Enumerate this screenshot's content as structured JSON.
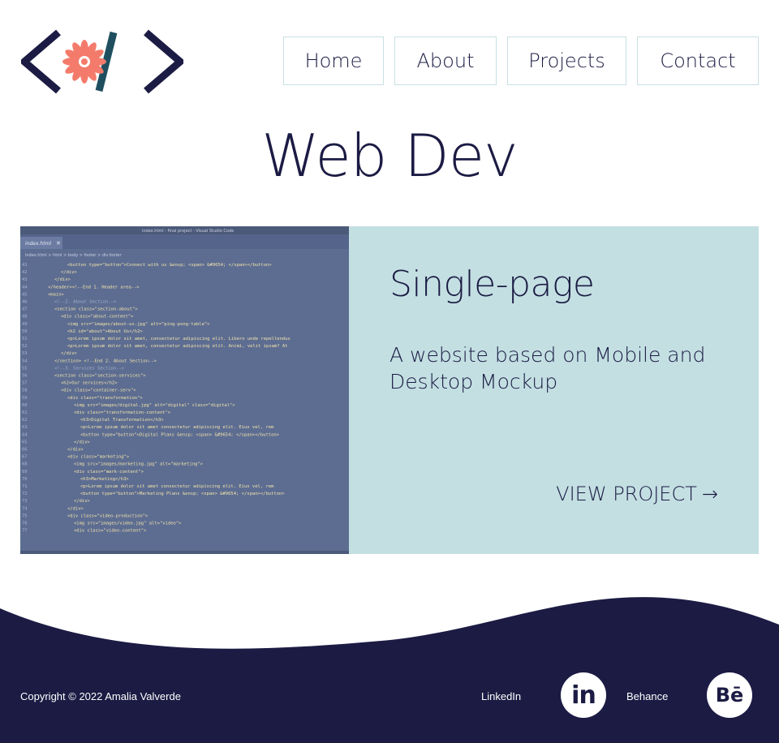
{
  "logo": {
    "alt": "code flower logo",
    "flower_color": "#f47b6b",
    "bracket_color": "#1b1b44",
    "slash_color": "#1f4f5f"
  },
  "nav": {
    "items": [
      {
        "label": "Home"
      },
      {
        "label": "About"
      },
      {
        "label": "Projects"
      },
      {
        "label": "Contact"
      }
    ]
  },
  "page": {
    "title": "Web Dev"
  },
  "project": {
    "title": "Single-page",
    "description": "A website based on Mobile and Desktop Mockup",
    "link_label": "VIEW PROJECT",
    "link_arrow": "→",
    "image_alt": "Visual Studio Code screenshot of index.html"
  },
  "screenshot_code": {
    "window_title": "index.html - final project - Visual Studio Code",
    "tab": "index.html",
    "breadcrumb": "index.html > html > body > footer > div.footer",
    "lines": [
      {
        "n": "41",
        "indent": 4,
        "text": "<button type=\"button\">Connect with us &ensp; <span> &#9654; </span></button>"
      },
      {
        "n": "42",
        "indent": 3,
        "text": "</div>"
      },
      {
        "n": "43",
        "indent": 2,
        "text": "</div>"
      },
      {
        "n": "44",
        "indent": 1,
        "text": "</header><!--End 1. Header area-->"
      },
      {
        "n": "45",
        "indent": 1,
        "text": "<main>"
      },
      {
        "n": "46",
        "indent": 2,
        "text": "<!--2. About Section-->"
      },
      {
        "n": "47",
        "indent": 2,
        "text": "<section class=\"section-about\">"
      },
      {
        "n": "48",
        "indent": 3,
        "text": "<div class=\"about-content\">"
      },
      {
        "n": "49",
        "indent": 4,
        "text": "<img src=\"images/about-us.jpg\" alt=\"ping-pong-table\">"
      },
      {
        "n": "50",
        "indent": 4,
        "text": "<h2 id=\"about\">About Us</h2>"
      },
      {
        "n": "51",
        "indent": 4,
        "text": "<p>Lorem ipsum dolor sit amet, consectetur adipiscing elit. Libero unde repellendus"
      },
      {
        "n": "52",
        "indent": 4,
        "text": "<p>Lorem ipsum dolor sit amet, consectetur adipiscing elit. Animi, velit ipsam? At"
      },
      {
        "n": "53",
        "indent": 3,
        "text": "</div>"
      },
      {
        "n": "54",
        "indent": 2,
        "text": "</section> <!--End 2. About Section-->"
      },
      {
        "n": "55",
        "indent": 2,
        "text": "<!--3. Services Section-->"
      },
      {
        "n": "56",
        "indent": 2,
        "text": "<section class=\"section-services\">"
      },
      {
        "n": "57",
        "indent": 3,
        "text": "<h2>Our services</h2>"
      },
      {
        "n": "58",
        "indent": 3,
        "text": "<div class=\"container-serv\">"
      },
      {
        "n": "59",
        "indent": 4,
        "text": "<div class=\"transformation\">"
      },
      {
        "n": "60",
        "indent": 5,
        "text": "<img src=\"images/digital.jpg\" alt=\"digital\" class=\"digital\">"
      },
      {
        "n": "61",
        "indent": 5,
        "text": "<div class=\"transformation-content\">"
      },
      {
        "n": "62",
        "indent": 6,
        "text": "<h3>Digital Transformation</h3>"
      },
      {
        "n": "63",
        "indent": 6,
        "text": "<p>Lorem ipsum dolor sit amet consectetur adipiscing elit. Eius vel, rem"
      },
      {
        "n": "64",
        "indent": 6,
        "text": "<button type=\"button\">Digital Plans &ensp; <span> &#9654; </span></button>"
      },
      {
        "n": "65",
        "indent": 5,
        "text": "</div>"
      },
      {
        "n": "66",
        "indent": 4,
        "text": "</div>"
      },
      {
        "n": "67",
        "indent": 4,
        "text": "<div class=\"marketing\">"
      },
      {
        "n": "68",
        "indent": 5,
        "text": "<img src=\"images/marketing.jpg\" alt=\"marketing\">"
      },
      {
        "n": "69",
        "indent": 5,
        "text": "<div class=\"mark-content\">"
      },
      {
        "n": "70",
        "indent": 6,
        "text": "<h3>Marketing</h3>"
      },
      {
        "n": "71",
        "indent": 6,
        "text": "<p>Lorem ipsum dolor sit amet consectetur adipiscing elit. Eius vel, rem"
      },
      {
        "n": "72",
        "indent": 6,
        "text": "<button type=\"button\">Marketing Plans &ensp; <span> &#9654; </span></button>"
      },
      {
        "n": "73",
        "indent": 5,
        "text": "</div>"
      },
      {
        "n": "74",
        "indent": 4,
        "text": "</div>"
      },
      {
        "n": "75",
        "indent": 4,
        "text": "<div class=\"video-production\">"
      },
      {
        "n": "76",
        "indent": 5,
        "text": "<img src=\"images/video.jpg\" alt=\"video\">"
      },
      {
        "n": "77",
        "indent": 5,
        "text": "<div class=\"video-content\">"
      }
    ]
  },
  "footer": {
    "copyright": "Copyright © 2022 Amalia Valverde",
    "linkedin_label": "LinkedIn",
    "linkedin_icon_text": "in",
    "behance_label": "Behance",
    "behance_icon_text": "Bē",
    "background_color": "#1b1b44"
  }
}
